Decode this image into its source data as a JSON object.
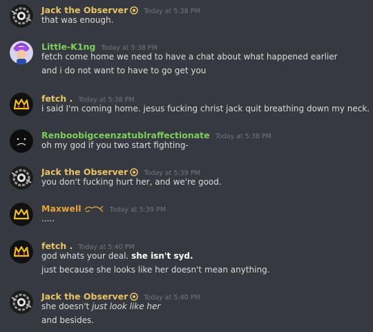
{
  "colors": {
    "background": "#36393f",
    "jack": "#e8c469",
    "little_k1ng": "#7ccf5c",
    "fetch": "#e8c469",
    "renboo": "#7ccf5c",
    "maxwell": "#e8a43c",
    "timestamp": "#72767d",
    "text": "#dcddde"
  },
  "messages": [
    {
      "author": "Jack the Observer",
      "avatar_icon": "eye-machine-avatar",
      "badge_icon": "eye-badge-icon",
      "time": "Today at 5:38 PM",
      "lines": [
        "that was enough."
      ]
    },
    {
      "author": "Little-K1ng",
      "avatar_icon": "purple-hair-character-avatar",
      "time": "Today at 5:38 PM",
      "lines": [
        "fetch come home we need to have a chat about what happened earlier",
        "and i do not want to have to go get you"
      ]
    },
    {
      "author": "fetch .",
      "avatar_icon": "yellow-crown-avatar",
      "time": "Today at 5:38 PM",
      "lines": [
        "i said I'm coming home. jesus fucking christ jack quit breathing down my neck."
      ]
    },
    {
      "author": "Renboobigceenzatublraffectionate",
      "avatar_icon": "sad-face-avatar",
      "time": "Today at 5:38 PM",
      "lines": [
        "oh my god if you two start fighting-"
      ]
    },
    {
      "author": "Jack the Observer",
      "avatar_icon": "eye-machine-avatar",
      "badge_icon": "eye-badge-icon",
      "time": "Today at 5:39 PM",
      "lines": [
        "you don't fucking hurt her, and we're good."
      ]
    },
    {
      "author": "Maxwell",
      "avatar_icon": "yellow-crown-avatar",
      "badge_icon": "fish-badge-icon",
      "time": "Today at 5:39 PM",
      "lines": [
        "....."
      ]
    },
    {
      "author": "fetch .",
      "avatar_icon": "yellow-crown-avatar",
      "time": "Today at 5:40 PM",
      "lines": [
        "god whats your deal.",
        "she isn't syd.",
        "just because she looks like her doesn't mean anything."
      ]
    },
    {
      "author": "Jack the Observer",
      "avatar_icon": "eye-machine-avatar",
      "badge_icon": "eye-badge-icon",
      "time": "Today at 5:40 PM",
      "lines": [
        "she doesn't",
        "just look like her",
        "and besides."
      ]
    }
  ]
}
